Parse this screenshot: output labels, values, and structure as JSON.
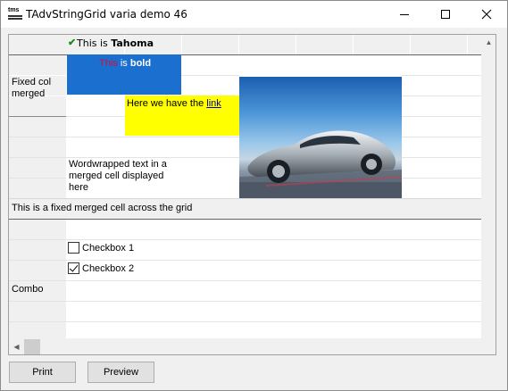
{
  "window": {
    "title": "TAdvStringGrid varia demo 46",
    "icon_label": "tms"
  },
  "grid": {
    "r0_prefix": "This is ",
    "r0_bold": "Tahoma",
    "blue_this": "This",
    "blue_is": " is ",
    "blue_bold": "bold",
    "fixed_merged_1": "Fixed col merged",
    "link_prefix": "Here we have the ",
    "link_text": "link",
    "wordwrap_text": "Wordwrapped text in a merged cell displayed here",
    "fixed_merged_across": "This is a fixed merged cell across the grid",
    "checkbox1": {
      "label": "Checkbox 1",
      "checked": false
    },
    "checkbox2": {
      "label": "Checkbox 2",
      "checked": true
    },
    "combo_label": "Combo"
  },
  "buttons": {
    "print": "Print",
    "preview": "Preview"
  },
  "colors": {
    "blue_cell": "#1a6fcf",
    "yellow_cell": "#ffff00",
    "this_text": "#d01040",
    "check": "#1a8a1a"
  }
}
